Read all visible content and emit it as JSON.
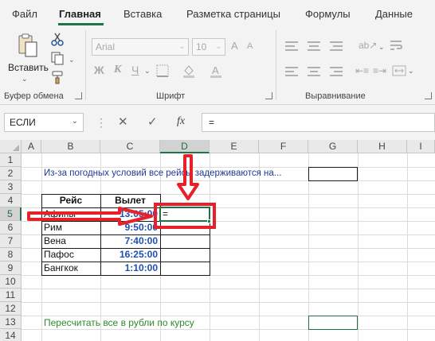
{
  "ribbon_tabs": [
    "Файл",
    "Главная",
    "Вставка",
    "Разметка страницы",
    "Формулы",
    "Данные"
  ],
  "active_tab": "Главная",
  "clipboard": {
    "paste_label": "Вставить",
    "group_label": "Буфер обмена"
  },
  "font": {
    "name": "Arial",
    "size": "10",
    "bold": "Ж",
    "italic": "К",
    "underline": "Ч",
    "grow": "A",
    "shrink": "A",
    "group_label": "Шрифт"
  },
  "alignment": {
    "group_label": "Выравнивание"
  },
  "name_box": "ЕСЛИ",
  "formula_buttons": {
    "cancel": "✕",
    "enter": "✓",
    "fx": "fx"
  },
  "formula_input": "=",
  "columns": [
    "A",
    "B",
    "C",
    "D",
    "E",
    "F",
    "G",
    "H",
    "I"
  ],
  "selected_column": "D",
  "rows": [
    "1",
    "2",
    "3",
    "4",
    "5",
    "6",
    "7",
    "8",
    "9",
    "10",
    "11",
    "12",
    "13",
    "14"
  ],
  "selected_row": "5",
  "note_row2": "Из-за погодных условий все рейсы задерживаются на...",
  "note_row13": "Пересчитать все в рубли по курсу",
  "table": {
    "headers": [
      "Рейс",
      "Вылет"
    ],
    "rows": [
      {
        "city": "Афины",
        "time": "13:05:00"
      },
      {
        "city": "Рим",
        "time": "9:50:00"
      },
      {
        "city": "Вена",
        "time": "7:40:00"
      },
      {
        "city": "Пафос",
        "time": "16:25:00"
      },
      {
        "city": "Бангкок",
        "time": "1:10:00"
      }
    ]
  },
  "active_cell_value": "=",
  "colors": {
    "accent": "#217346",
    "annotation_red": "#e8202a",
    "note_blue": "#1f3a93",
    "note_green": "#2c8a2c",
    "time_blue": "#1f4fb0"
  }
}
